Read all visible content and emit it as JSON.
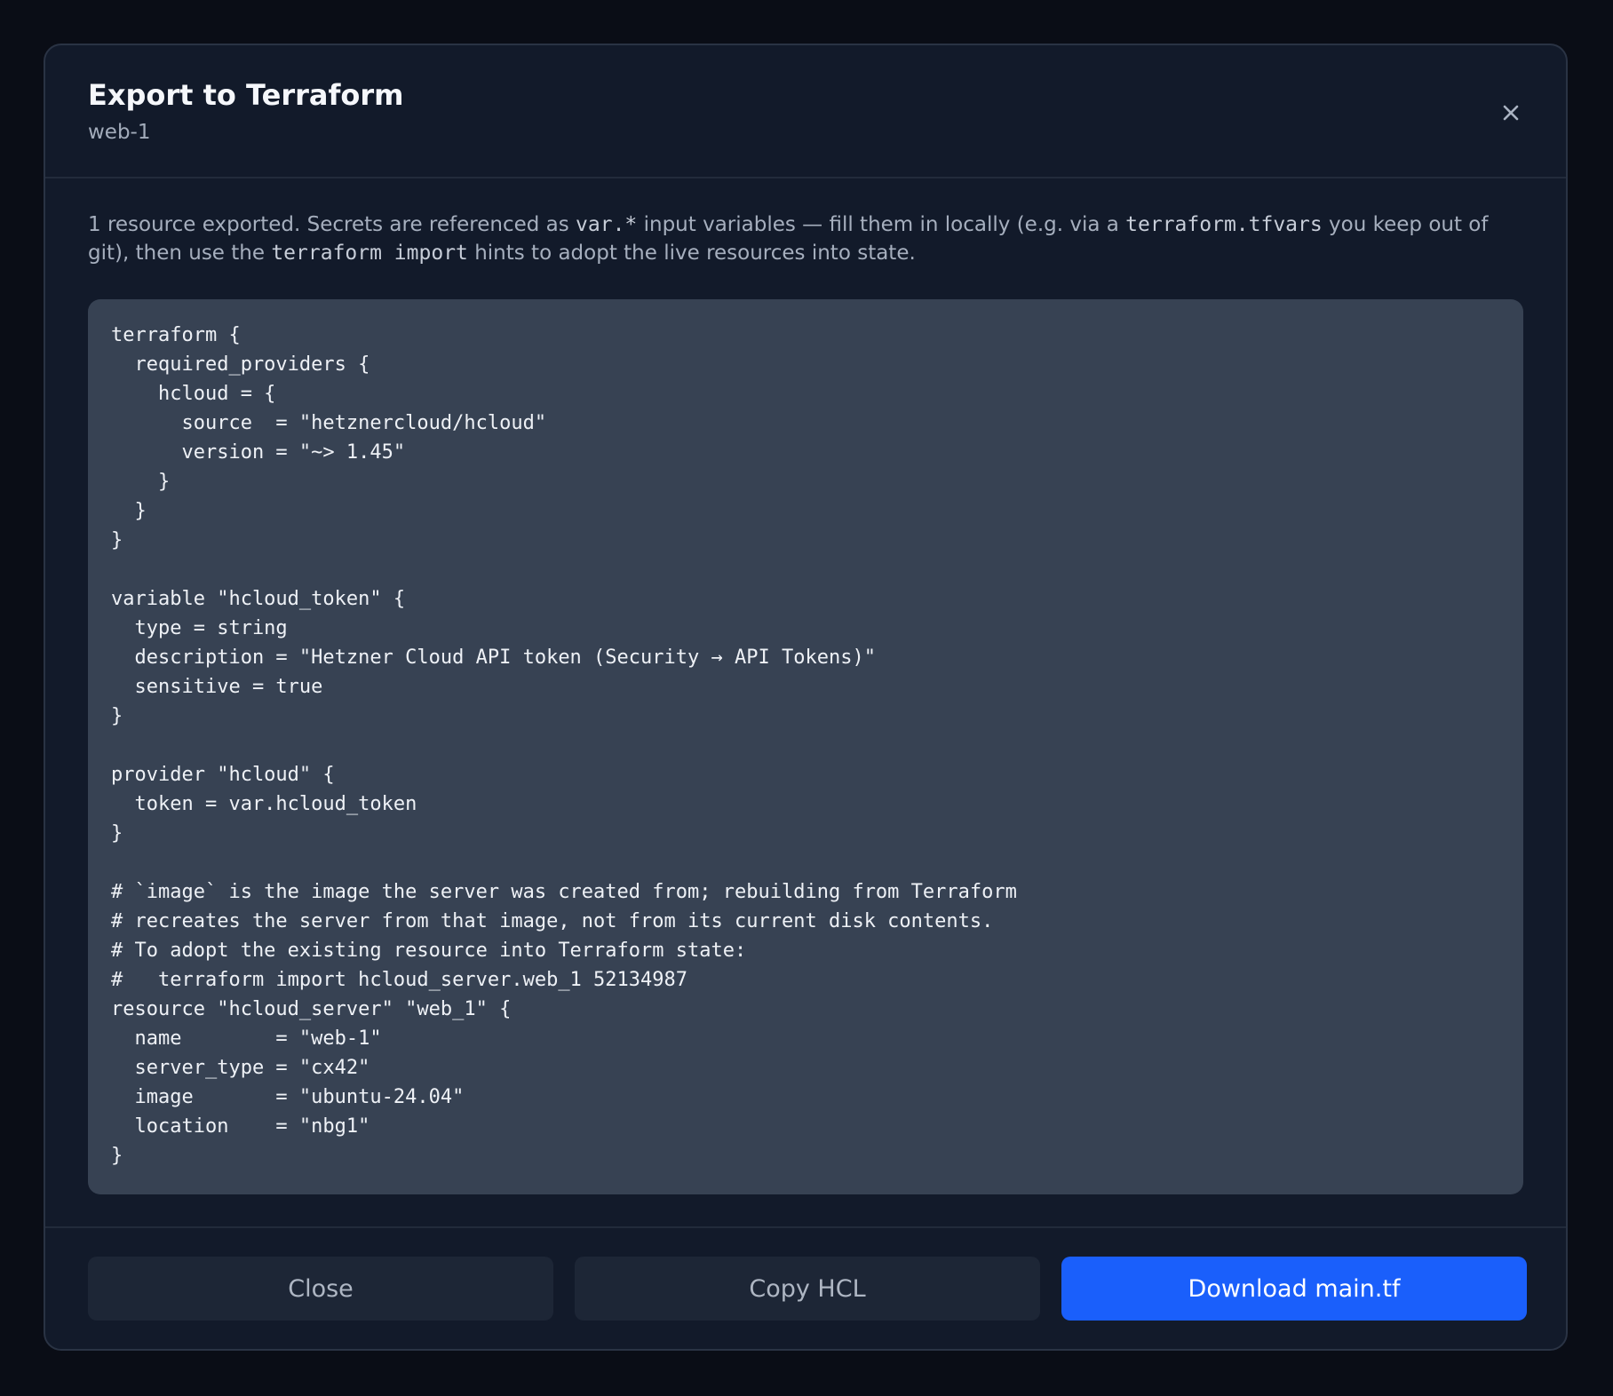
{
  "dialog": {
    "title": "Export to Terraform",
    "subtitle": "web-1",
    "close_icon": "close-icon"
  },
  "note": {
    "part1": "1 resource exported. Secrets are referenced as ",
    "code1": "var.*",
    "part2": " input variables — fill them in locally (e.g. via a ",
    "code2": "terraform.tfvars",
    "part3": " you keep out of git), then use the ",
    "code3": "terraform import",
    "part4": " hints to adopt the live resources into state."
  },
  "code": {
    "hcl": "terraform {\n  required_providers {\n    hcloud = {\n      source  = \"hetznercloud/hcloud\"\n      version = \"~> 1.45\"\n    }\n  }\n}\n\nvariable \"hcloud_token\" {\n  type = string\n  description = \"Hetzner Cloud API token (Security → API Tokens)\"\n  sensitive = true\n}\n\nprovider \"hcloud\" {\n  token = var.hcloud_token\n}\n\n# `image` is the image the server was created from; rebuilding from Terraform\n# recreates the server from that image, not from its current disk contents.\n# To adopt the existing resource into Terraform state:\n#   terraform import hcloud_server.web_1 52134987\nresource \"hcloud_server\" \"web_1\" {\n  name        = \"web-1\"\n  server_type = \"cx42\"\n  image       = \"ubuntu-24.04\"\n  location    = \"nbg1\"\n}"
  },
  "footer": {
    "close_label": "Close",
    "copy_label": "Copy HCL",
    "download_label": "Download main.tf"
  },
  "colors": {
    "background": "#0a0d16",
    "modal": "#121a2a",
    "code_bg": "#374253",
    "primary": "#1a5ffb",
    "secondary_button": "#1d2636"
  }
}
